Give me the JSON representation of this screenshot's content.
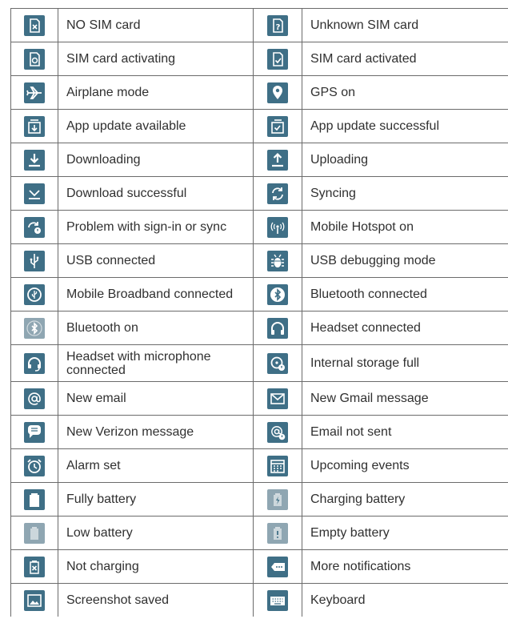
{
  "rows": [
    {
      "left": {
        "icon": "sim-x-icon",
        "label": "NO SIM card"
      },
      "right": {
        "icon": "sim-question-icon",
        "label": "Unknown SIM card"
      }
    },
    {
      "left": {
        "icon": "sim-sync-icon",
        "label": "SIM card activating"
      },
      "right": {
        "icon": "sim-check-icon",
        "label": "SIM card activated"
      }
    },
    {
      "left": {
        "icon": "airplane-icon",
        "label": "Airplane mode"
      },
      "right": {
        "icon": "location-pin-icon",
        "label": "GPS on"
      }
    },
    {
      "left": {
        "icon": "app-update-icon",
        "label": "App update available"
      },
      "right": {
        "icon": "app-update-success-icon",
        "label": "App update successful"
      }
    },
    {
      "left": {
        "icon": "download-icon",
        "label": "Downloading"
      },
      "right": {
        "icon": "upload-icon",
        "label": "Uploading"
      }
    },
    {
      "left": {
        "icon": "download-done-icon",
        "label": "Download successful"
      },
      "right": {
        "icon": "sync-icon",
        "label": "Syncing"
      }
    },
    {
      "left": {
        "icon": "sync-problem-icon",
        "label": "Problem with sign-in or sync"
      },
      "right": {
        "icon": "hotspot-icon",
        "label": "Mobile Hotspot on"
      }
    },
    {
      "left": {
        "icon": "usb-icon",
        "label": "USB connected"
      },
      "right": {
        "icon": "usb-debug-icon",
        "label": "USB debugging mode"
      }
    },
    {
      "left": {
        "icon": "mobile-broadband-icon",
        "label": "Mobile Broadband connected"
      },
      "right": {
        "icon": "bluetooth-connected-icon",
        "label": "Bluetooth connected"
      }
    },
    {
      "left": {
        "icon": "bluetooth-icon",
        "label": "Bluetooth on"
      },
      "right": {
        "icon": "headset-icon",
        "label": "Headset connected"
      }
    },
    {
      "left": {
        "icon": "headset-mic-icon",
        "label": "Headset with microphone connected"
      },
      "right": {
        "icon": "storage-full-icon",
        "label": "Internal storage full"
      }
    },
    {
      "left": {
        "icon": "email-icon",
        "label": "New email"
      },
      "right": {
        "icon": "gmail-icon",
        "label": "New Gmail message"
      }
    },
    {
      "left": {
        "icon": "message-icon",
        "label": "New Verizon message"
      },
      "right": {
        "icon": "email-error-icon",
        "label": "Email not sent"
      }
    },
    {
      "left": {
        "icon": "alarm-icon",
        "label": "Alarm set"
      },
      "right": {
        "icon": "calendar-icon",
        "label": "Upcoming events"
      }
    },
    {
      "left": {
        "icon": "battery-full-icon",
        "label": "Fully battery"
      },
      "right": {
        "icon": "battery-charging-icon",
        "label": "Charging battery"
      }
    },
    {
      "left": {
        "icon": "battery-low-icon",
        "label": "Low battery"
      },
      "right": {
        "icon": "battery-empty-icon",
        "label": "Empty battery"
      }
    },
    {
      "left": {
        "icon": "battery-not-charging-icon",
        "label": "Not charging"
      },
      "right": {
        "icon": "more-notifications-icon",
        "label": "More notifications"
      }
    },
    {
      "left": {
        "icon": "screenshot-icon",
        "label": "Screenshot saved"
      },
      "right": {
        "icon": "keyboard-icon",
        "label": "Keyboard"
      }
    }
  ],
  "colors": {
    "icon_bg": "#3f6f86",
    "icon_bg_light": "#8fa6b2",
    "border": "#6b6b6b",
    "text": "#303030"
  }
}
